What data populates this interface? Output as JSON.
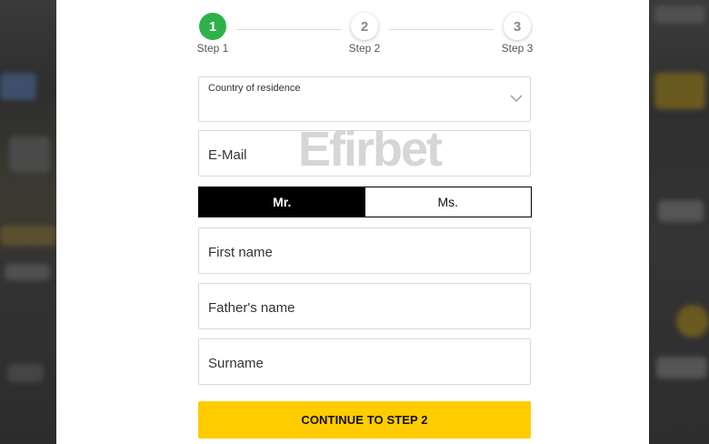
{
  "stepper": {
    "steps": [
      {
        "number": "1",
        "label": "Step 1",
        "state": "active"
      },
      {
        "number": "2",
        "label": "Step 2",
        "state": "inactive"
      },
      {
        "number": "3",
        "label": "Step 3",
        "state": "inactive"
      }
    ]
  },
  "form": {
    "country_label": "Country of residence",
    "email_label": "E-Mail",
    "gender_options": [
      "Mr.",
      "Ms."
    ],
    "gender_selected": "Mr.",
    "first_name_label": "First name",
    "father_name_label": "Father's name",
    "surname_label": "Surname",
    "continue_label": "CONTINUE TO STEP 2"
  },
  "watermark": {
    "text": "Efirbet"
  },
  "colors": {
    "active_step": "#2fb14a",
    "cta": "#ffcc00",
    "gender_selected_bg": "#000000"
  },
  "icons": {
    "country_dropdown": "chevron-down-icon"
  }
}
